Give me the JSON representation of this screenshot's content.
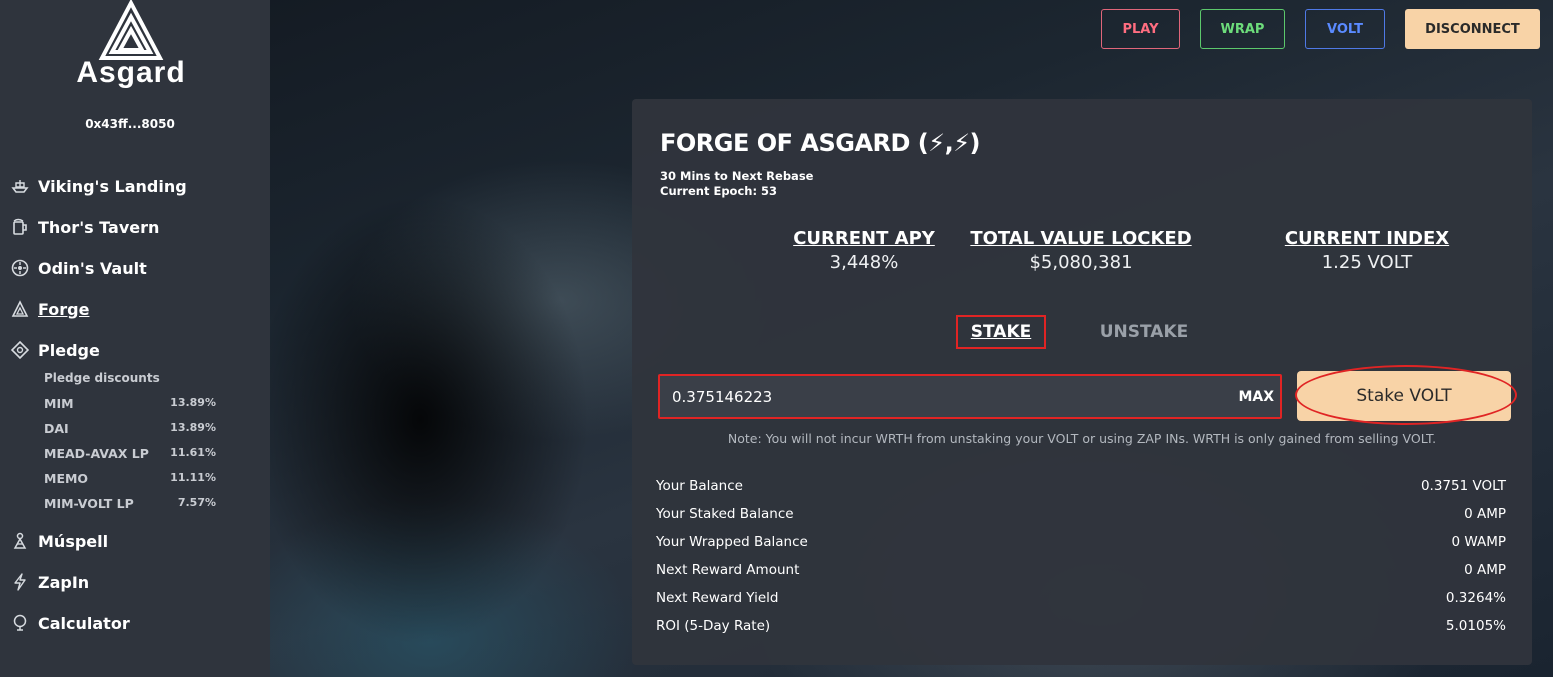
{
  "brand": {
    "name": "Asgard",
    "wallet": "0x43ff...8050"
  },
  "sidebar": {
    "items": [
      {
        "label": "Viking's Landing",
        "icon": "ship-icon"
      },
      {
        "label": "Thor's Tavern",
        "icon": "mug-icon"
      },
      {
        "label": "Odin's Vault",
        "icon": "vault-icon"
      },
      {
        "label": "Forge",
        "icon": "forge-icon",
        "active": true
      },
      {
        "label": "Pledge",
        "icon": "pledge-icon"
      },
      {
        "label": "Múspell",
        "icon": "muspell-icon"
      },
      {
        "label": "ZapIn",
        "icon": "zap-icon"
      },
      {
        "label": "Calculator",
        "icon": "calculator-icon"
      }
    ],
    "pledge_discounts": {
      "title": "Pledge discounts",
      "rows": [
        {
          "name": "MIM",
          "pct": "13.89%"
        },
        {
          "name": "DAI",
          "pct": "13.89%"
        },
        {
          "name": "MEAD-AVAX LP",
          "pct": "11.61%"
        },
        {
          "name": "MEMO",
          "pct": "11.11%"
        },
        {
          "name": "MIM-VOLT LP",
          "pct": "7.57%"
        }
      ]
    }
  },
  "topbar": {
    "play": "PLAY",
    "wrap": "WRAP",
    "volt": "VOLT",
    "disconnect": "DISCONNECT"
  },
  "forge": {
    "title": "FORGE OF ASGARD (⚡,⚡)",
    "rebase": "30 Mins to Next Rebase",
    "epoch": "Current Epoch: 53",
    "stats": {
      "apy_label": "CURRENT APY",
      "apy_value": "3,448%",
      "tvl_label": "TOTAL VALUE LOCKED",
      "tvl_value": "$5,080,381",
      "index_label": "CURRENT INDEX",
      "index_value": "1.25 VOLT"
    },
    "tabs": {
      "stake": "STAKE",
      "unstake": "UNSTAKE"
    },
    "amount_value": "0.375146223",
    "max_label": "MAX",
    "stake_button": "Stake VOLT",
    "note": "Note: You will not incur WRTH from unstaking your VOLT or using ZAP INs. WRTH is only gained from selling VOLT.",
    "info": [
      {
        "label": "Your Balance",
        "value": "0.3751 VOLT"
      },
      {
        "label": "Your Staked Balance",
        "value": "0 AMP"
      },
      {
        "label": "Your Wrapped Balance",
        "value": "0 WAMP"
      },
      {
        "label": "Next Reward Amount",
        "value": "0 AMP"
      },
      {
        "label": "Next Reward Yield",
        "value": "0.3264%"
      },
      {
        "label": "ROI (5-Day Rate)",
        "value": "5.0105%"
      }
    ]
  },
  "colors": {
    "accent": "#f8d3a7",
    "play": "#ff6d80",
    "wrap": "#6ddc7b",
    "volt": "#5a8aff",
    "highlight": "#e02424"
  }
}
